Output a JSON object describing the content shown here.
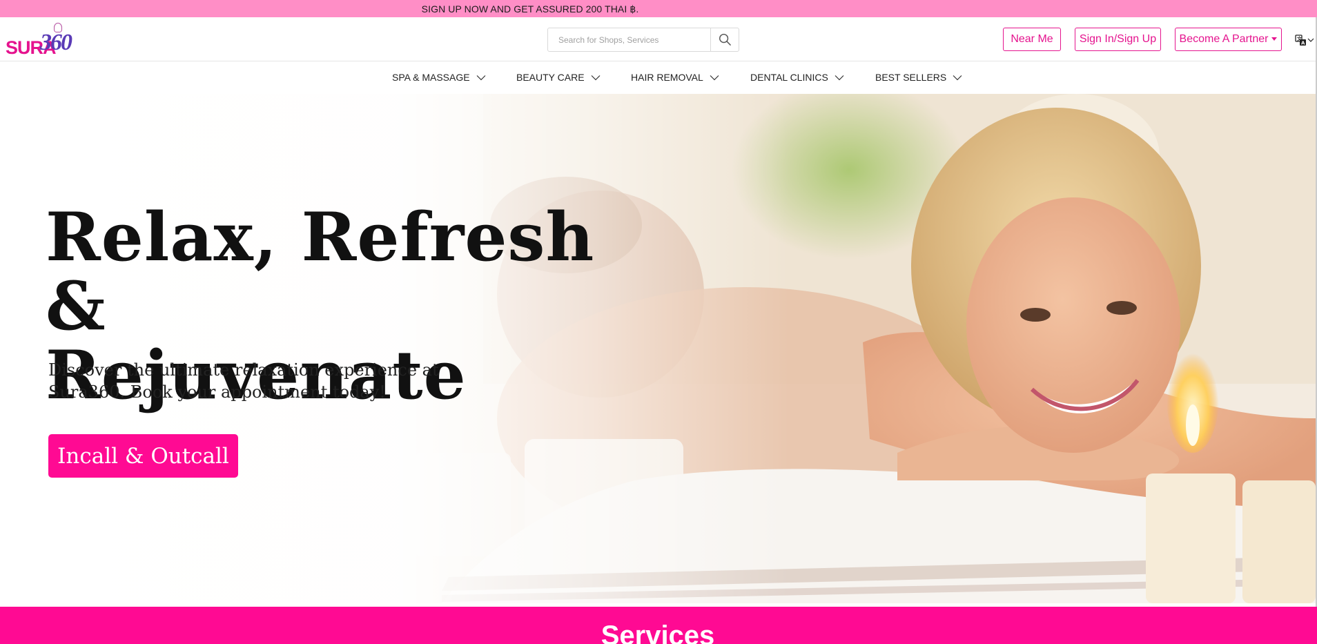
{
  "promo": {
    "text": "SIGN UP NOW AND GET ASSURED 200 THAI ฿."
  },
  "header": {
    "logo_text": "SURA",
    "logo_number": "360",
    "search_placeholder": "Search for Shops, Services",
    "buttons": {
      "near_me": "Near Me",
      "sign_in": "Sign In/Sign Up",
      "partner": "Become A Partner"
    },
    "language_icon": "translate-icon"
  },
  "nav": {
    "items": [
      {
        "label": "SPA & MASSAGE",
        "icon": "chevron-down-icon"
      },
      {
        "label": "BEAUTY CARE",
        "icon": "chevron-down-icon"
      },
      {
        "label": "HAIR REMOVAL",
        "icon": "chevron-down-icon"
      },
      {
        "label": "DENTAL CLINICS",
        "icon": "chevron-down-icon"
      },
      {
        "label": "BEST SELLERS",
        "icon": "chevron-down-icon"
      }
    ]
  },
  "hero": {
    "title_line1": "Relax, Refresh &",
    "title_line2": "Rejuvenate",
    "subtitle_line1": "Discover the ultimate relaxation experience at",
    "subtitle_line2": "Sura360. Book your appointment today!",
    "cta": "Incall & Outcall"
  },
  "services": {
    "title": "Services"
  },
  "colors": {
    "accent": "#e5138e",
    "cta": "#ff0a93",
    "promo_bar": "#ff8ec6",
    "logo_purple": "#5a3ab6"
  }
}
